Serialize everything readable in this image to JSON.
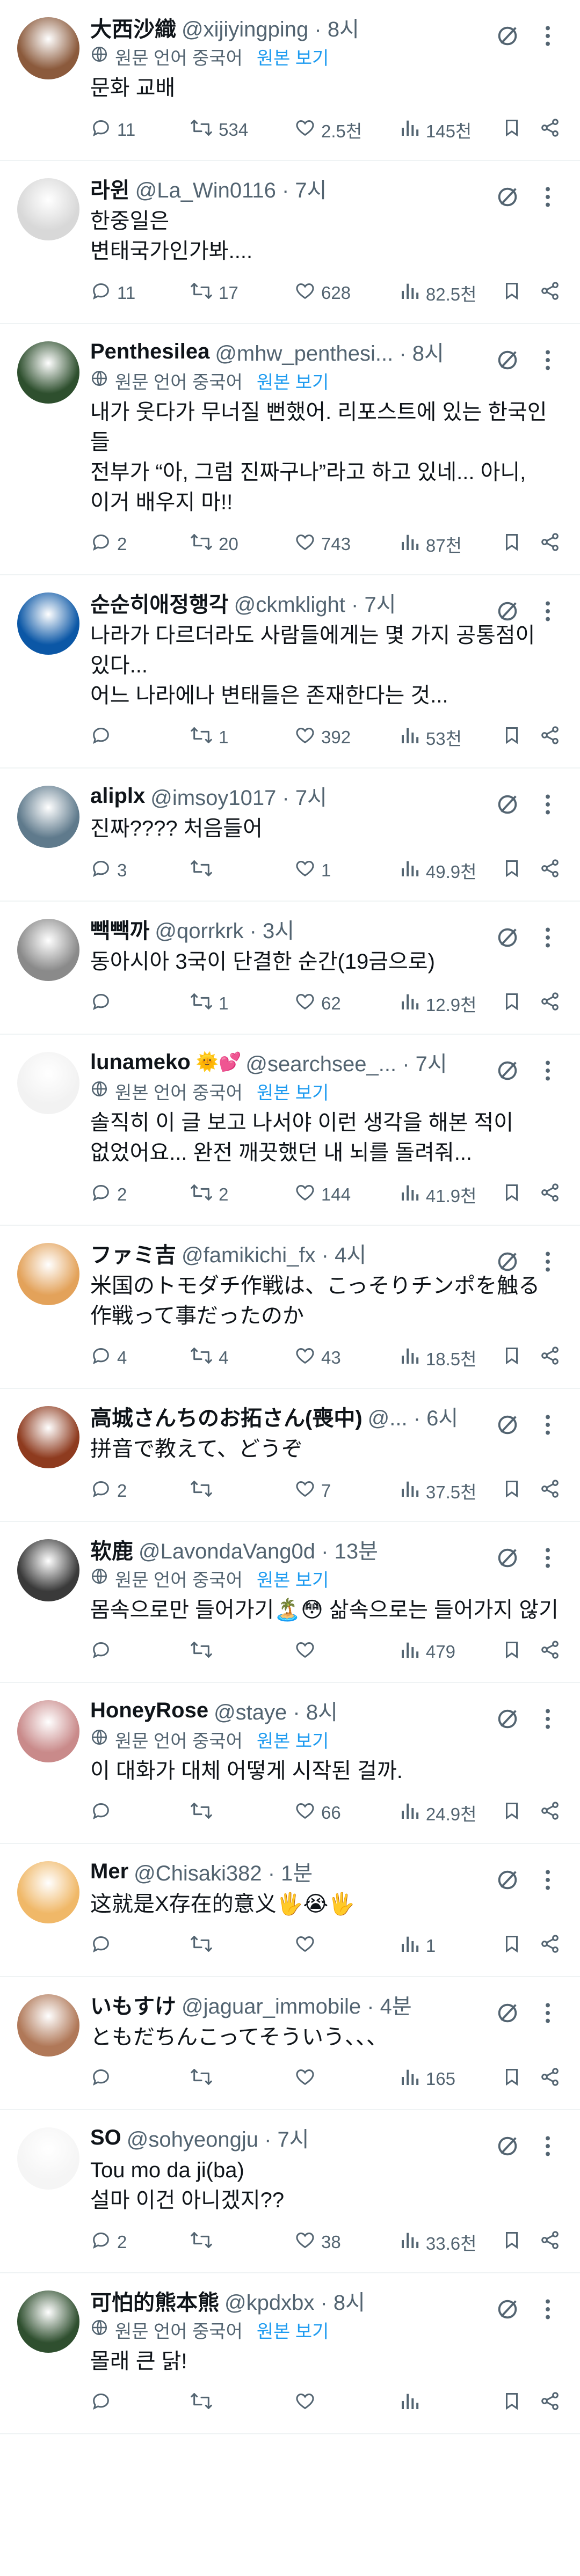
{
  "labels": {
    "translated_from": "원문 언어 중국어",
    "show_original": "원본 보기",
    "translated_from_alt": "원본 언어 중국어"
  },
  "colors": {
    "accent": "#1d9bf0",
    "muted": "#536471",
    "divider": "#eff3f4"
  },
  "tweets": [
    {
      "avatar_color": "#8b5a3c",
      "avatar_icon": "illustrated-portrait-avatar",
      "display_name": "大西沙織",
      "handle": "@xijiyingping",
      "time": "8시",
      "translated": true,
      "translated_label": "원문 언어 중국어",
      "text": "문화 교배",
      "replies": "11",
      "retweets": "534",
      "likes": "2.5천",
      "views": "145천"
    },
    {
      "avatar_color": "#d8d8d8",
      "avatar_icon": "sketch-avatar",
      "display_name": "라윈",
      "handle": "@La_Win0116",
      "time": "7시",
      "translated": false,
      "text": "한중일은\n변태국가인가봐....",
      "replies": "11",
      "retweets": "17",
      "likes": "628",
      "views": "82.5천"
    },
    {
      "avatar_color": "#2e4f2e",
      "avatar_icon": "photo-avatar",
      "display_name": "Penthesilea",
      "handle": "@mhw_penthesi...",
      "time": "8시",
      "translated": true,
      "translated_label": "원문 언어 중국어",
      "text": "내가 웃다가 무너질 뻔했어. 리포스트에 있는 한국인들\n전부가 “아, 그럼 진짜구나”라고 하고 있네... 아니,\n이거 배우지 마!!",
      "replies": "2",
      "retweets": "20",
      "likes": "743",
      "views": "87천"
    },
    {
      "avatar_color": "#0b57a6",
      "avatar_icon": "blue-circle-avatar",
      "display_name": "순순히애정행각",
      "handle": "@ckmklight",
      "time": "7시",
      "translated": false,
      "text": "나라가 다르더라도 사람들에게는 몇 가지 공통점이\n있다...\n어느 나라에나 변태들은 존재한다는 것...",
      "replies": "",
      "retweets": "1",
      "likes": "392",
      "views": "53천"
    },
    {
      "avatar_color": "#5f7a8c",
      "avatar_icon": "flower-photo-avatar",
      "display_name": "aliplx",
      "handle": "@imsoy1017",
      "time": "7시",
      "translated": false,
      "text": "진짜???? 처음들어",
      "replies": "3",
      "retweets": "",
      "likes": "1",
      "views": "49.9천"
    },
    {
      "avatar_color": "#8a8a8a",
      "avatar_icon": "grayscale-photo-avatar",
      "display_name": "빽빽까",
      "handle": "@qorrkrk",
      "time": "3시",
      "translated": false,
      "text": "동아시아 3국이 단결한 순간(19금으로)",
      "replies": "",
      "retweets": "1",
      "likes": "62",
      "views": "12.9천"
    },
    {
      "avatar_color": "#f2f2f2",
      "avatar_icon": "cartoon-fish-avatar",
      "display_name": "lunameko",
      "name_emoji": "🌞💕",
      "handle": "@searchsee_...",
      "time": "7시",
      "translated": true,
      "translated_label": "원본 언어 중국어",
      "text": "솔직히 이 글 보고 나서야 이런 생각을 해본 적이\n없었어요... 완전 깨끗했던 내 뇌를 돌려줘...",
      "replies": "2",
      "retweets": "2",
      "likes": "144",
      "views": "41.9천"
    },
    {
      "avatar_color": "#e3a25a",
      "avatar_icon": "anime-girl-avatar",
      "display_name": "ファミ吉",
      "handle": "@famikichi_fx",
      "time": "4시",
      "translated": false,
      "text": "米国のトモダチ作戦は、こっそりチンポを触る\n作戦って事だったのか",
      "replies": "4",
      "retweets": "4",
      "likes": "43",
      "views": "18.5천"
    },
    {
      "avatar_color": "#8e3b1f",
      "avatar_icon": "food-photo-avatar",
      "display_name": "高城さんちのお拓さん(喪中)",
      "handle": "@...",
      "time": "6시",
      "translated": false,
      "text": "拼音で教えて、どうぞ",
      "replies": "2",
      "retweets": "",
      "likes": "7",
      "views": "37.5천"
    },
    {
      "avatar_color": "#3a3a3a",
      "avatar_icon": "portrait-photo-avatar",
      "display_name": "软鹿",
      "handle": "@LavondaVang0d",
      "time": "13분",
      "translated": true,
      "translated_label": "원문 언어 중국어",
      "text": "몸속으로만 들어가기🏝️😳 삶속으로는 들어가지 않기",
      "replies": "",
      "retweets": "",
      "likes": "",
      "views": "479"
    },
    {
      "avatar_color": "#c98a8a",
      "avatar_icon": "portrait-photo-avatar",
      "display_name": "HoneyRose",
      "handle": "@staye",
      "time": "8시",
      "translated": true,
      "translated_label": "원문 언어 중국어",
      "text": "이 대화가 대체 어떻게 시작된 걸까.",
      "replies": "",
      "retweets": "",
      "likes": "66",
      "views": "24.9천"
    },
    {
      "avatar_color": "#f0b868",
      "avatar_icon": "anime-avatar",
      "display_name": "Mer",
      "handle": "@Chisaki382",
      "time": "1분",
      "translated": false,
      "text": "这就是X存在的意义🖐️😭🖐️",
      "replies": "",
      "retweets": "",
      "likes": "",
      "views": "1"
    },
    {
      "avatar_color": "#b07858",
      "avatar_icon": "bald-man-photo-avatar",
      "display_name": "いもすけ",
      "handle": "@jaguar_immobile",
      "time": "4분",
      "translated": false,
      "text": "ともだちんこってそういう、、、",
      "replies": "",
      "retweets": "",
      "likes": "",
      "views": "165"
    },
    {
      "avatar_color": "#f5f5f5",
      "avatar_icon": "maid-figure-avatar",
      "display_name": "SO",
      "handle": "@sohyeongju",
      "time": "7시",
      "translated": false,
      "text": "Tou mo da ji(ba)\n설마 이건 아니겠지??",
      "replies": "2",
      "retweets": "",
      "likes": "38",
      "views": "33.6천"
    },
    {
      "avatar_color": "#2f4f2f",
      "avatar_icon": "racer-photo-avatar",
      "display_name": "可怕的熊本熊",
      "handle": "@kpdxbx",
      "time": "8시",
      "translated": true,
      "translated_label": "원문 언어 중국어",
      "text": "몰래 큰 닭!",
      "replies": "",
      "retweets": "",
      "likes": "",
      "views": ""
    }
  ]
}
